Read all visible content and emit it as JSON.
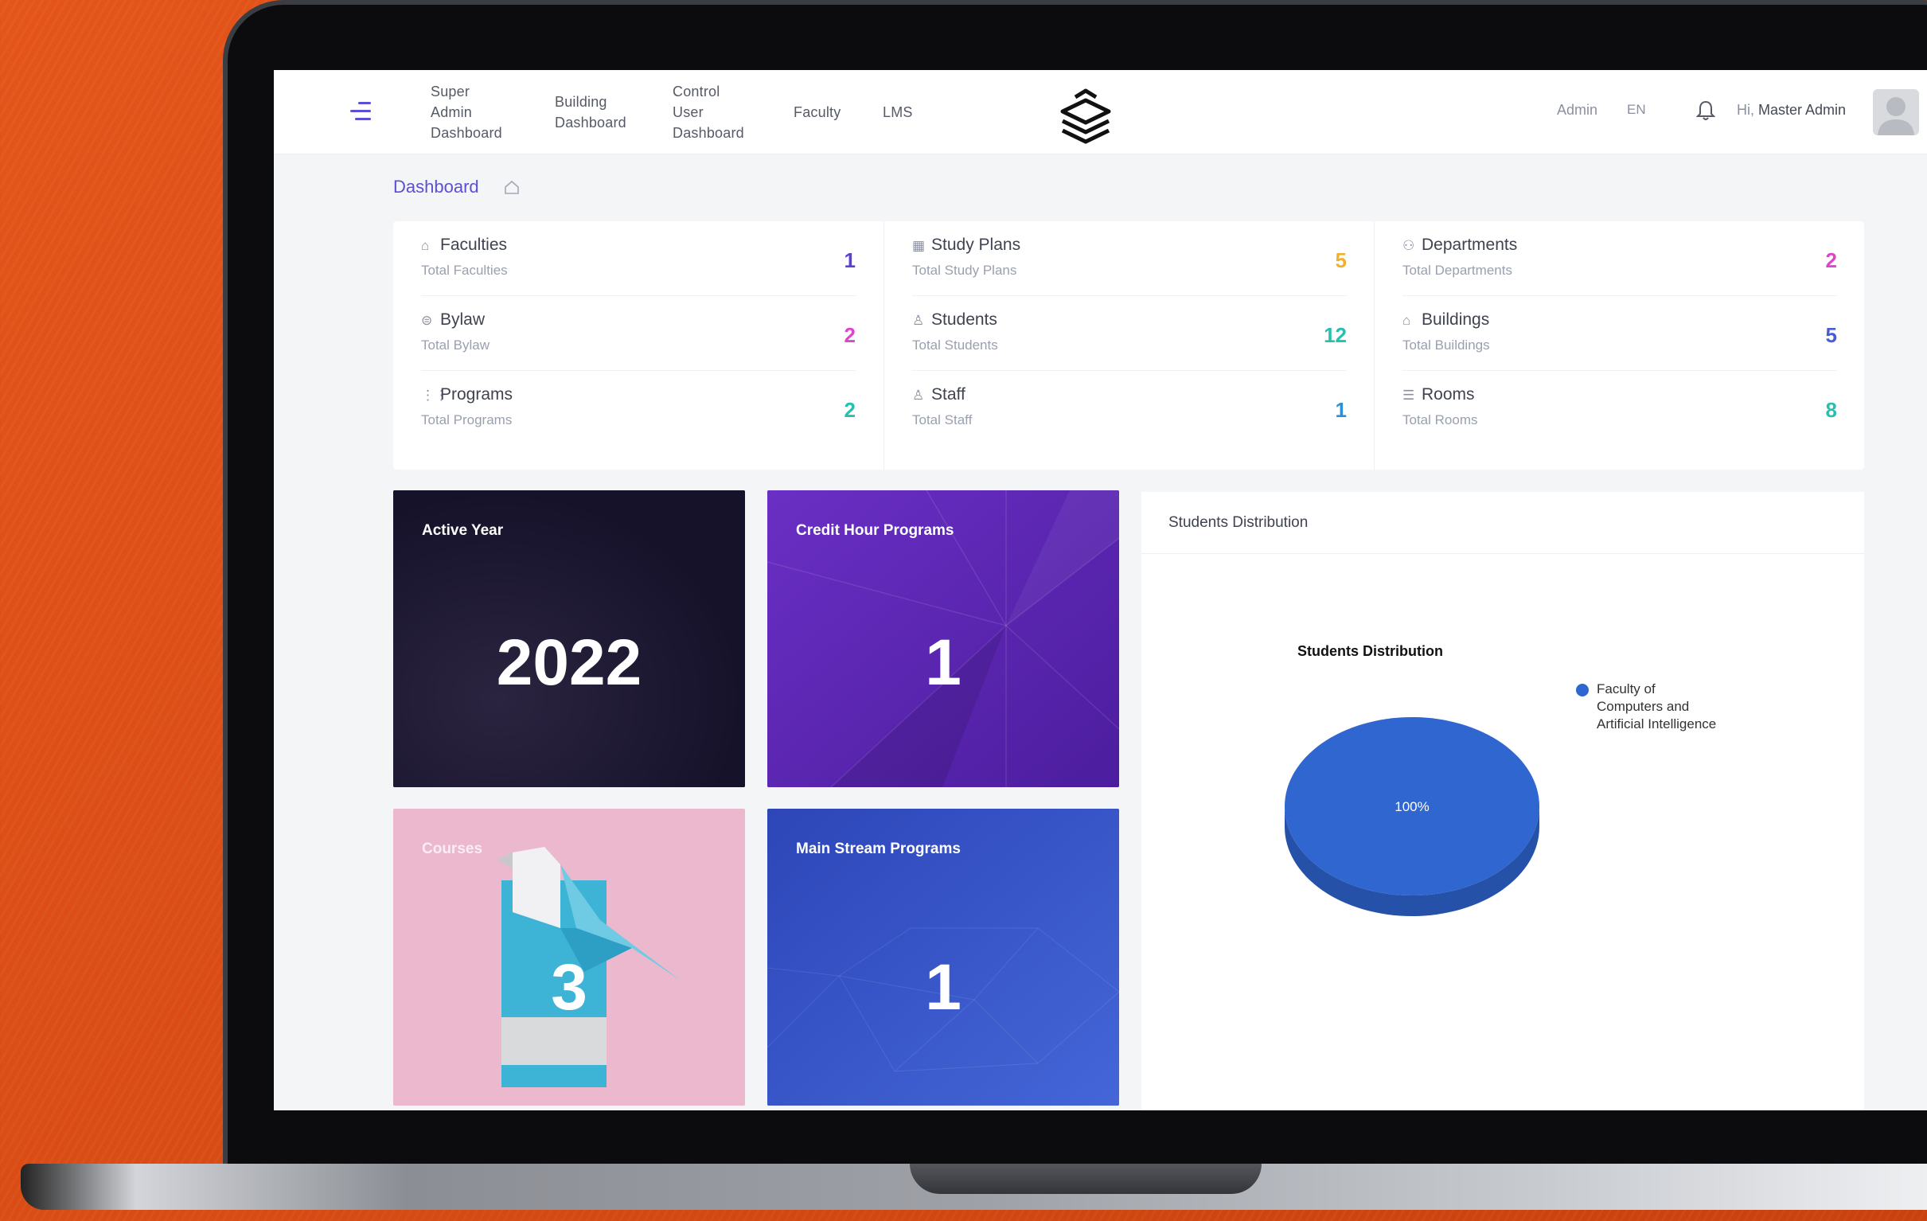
{
  "header": {
    "nav": [
      {
        "label": "Super Admin Dashboard",
        "lines": [
          "Super",
          "Admin",
          "Dashboard"
        ]
      },
      {
        "label": "Building Dashboard",
        "lines": [
          "Building",
          "Dashboard"
        ]
      },
      {
        "label": "Control User Dashboard",
        "lines": [
          "Control",
          "User",
          "Dashboard"
        ]
      },
      {
        "label": "Faculty",
        "lines": [
          "Faculty"
        ]
      },
      {
        "label": "LMS",
        "lines": [
          "LMS"
        ]
      }
    ],
    "admin_link": "Admin",
    "language": "EN",
    "greeting_prefix": "Hi,",
    "user_name": "Master Admin"
  },
  "breadcrumb": {
    "title": "Dashboard"
  },
  "stats": [
    {
      "title": "Faculties",
      "subtitle": "Total Faculties",
      "value": "1",
      "color": "#5b3fd6",
      "icon": "faculty-icon"
    },
    {
      "title": "Bylaw",
      "subtitle": "Total Bylaw",
      "value": "2",
      "color": "#e045c9",
      "icon": "bylaw-icon"
    },
    {
      "title": "Programs",
      "subtitle": "Total Programs",
      "value": "2",
      "color": "#25c0b0",
      "icon": "programs-icon"
    },
    {
      "title": "Study Plans",
      "subtitle": "Total Study Plans",
      "value": "5",
      "color": "#f1b12c",
      "icon": "study-plans-icon"
    },
    {
      "title": "Students",
      "subtitle": "Total Students",
      "value": "12",
      "color": "#25c0b0",
      "icon": "students-icon"
    },
    {
      "title": "Staff",
      "subtitle": "Total Staff",
      "value": "1",
      "color": "#2f8fd6",
      "icon": "staff-icon"
    },
    {
      "title": "Departments",
      "subtitle": "Total Departments",
      "value": "2",
      "color": "#e045c9",
      "icon": "departments-icon"
    },
    {
      "title": "Buildings",
      "subtitle": "Total Buildings",
      "value": "5",
      "color": "#4a5bd6",
      "icon": "buildings-icon"
    },
    {
      "title": "Rooms",
      "subtitle": "Total Rooms",
      "value": "8",
      "color": "#25c0b0",
      "icon": "rooms-icon"
    }
  ],
  "tiles": {
    "active_year": {
      "label": "Active Year",
      "value": "2022"
    },
    "credit_hour": {
      "label": "Credit Hour Programs",
      "value": "1"
    },
    "courses": {
      "label": "Courses",
      "value": "3"
    },
    "main_stream": {
      "label": "Main Stream Programs",
      "value": "1"
    }
  },
  "chart_card": {
    "title": "Students Distribution"
  },
  "chart_data": {
    "type": "pie",
    "title": "Students Distribution",
    "categories": [
      "Faculty of Computers and Artificial Intelligence"
    ],
    "values": [
      100
    ],
    "value_labels": [
      "100%"
    ],
    "colors": [
      "#3066cf"
    ],
    "legend_position": "right"
  }
}
